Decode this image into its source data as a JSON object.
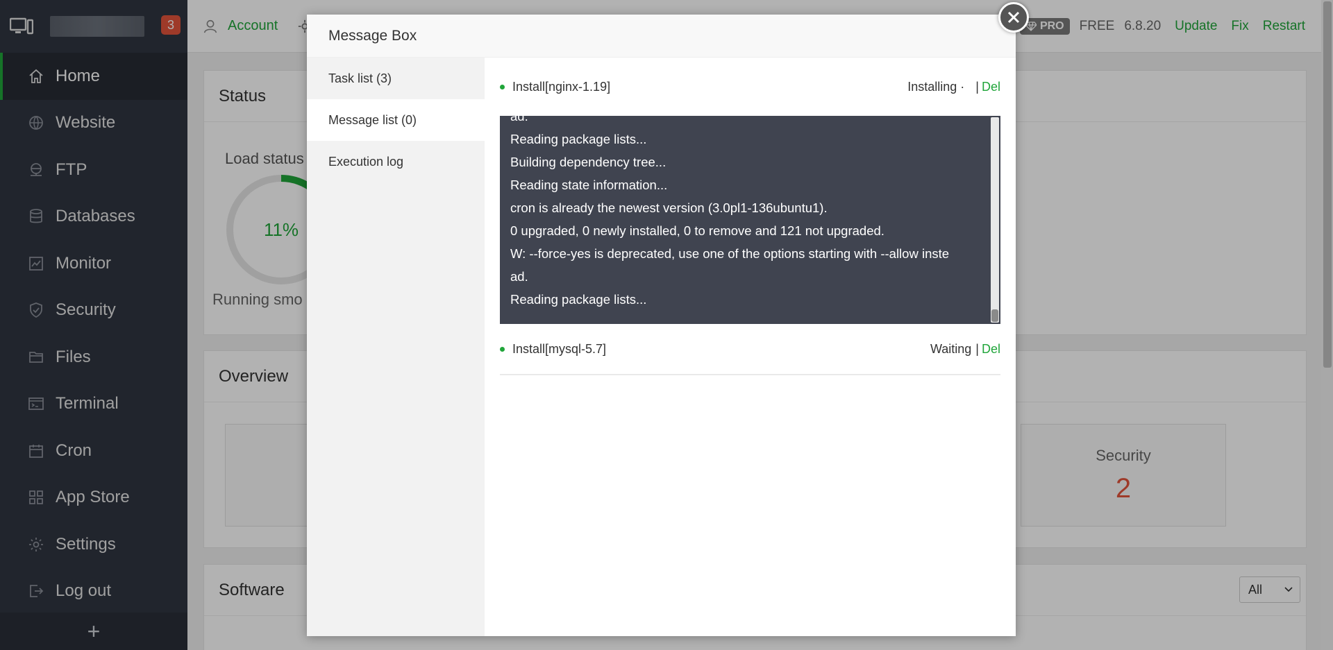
{
  "sidebar": {
    "badge_count": "3",
    "items": [
      {
        "label": "Home",
        "icon": "home-icon"
      },
      {
        "label": "Website",
        "icon": "globe-icon"
      },
      {
        "label": "FTP",
        "icon": "ftp-icon"
      },
      {
        "label": "Databases",
        "icon": "database-icon"
      },
      {
        "label": "Monitor",
        "icon": "monitor-chart-icon"
      },
      {
        "label": "Security",
        "icon": "shield-icon"
      },
      {
        "label": "Files",
        "icon": "folder-icon"
      },
      {
        "label": "Terminal",
        "icon": "terminal-icon"
      },
      {
        "label": "Cron",
        "icon": "calendar-icon"
      },
      {
        "label": "App Store",
        "icon": "grid-icon"
      },
      {
        "label": "Settings",
        "icon": "gear-icon"
      },
      {
        "label": "Log out",
        "icon": "logout-icon"
      }
    ],
    "add_label": "+"
  },
  "topbar": {
    "account_label": "Account",
    "pro_label": "PRO",
    "free_label": "FREE",
    "version": "6.8.20",
    "update_label": "Update",
    "fix_label": "Fix",
    "restart_label": "Restart"
  },
  "status": {
    "title": "Status",
    "load_title": "Load status",
    "load_percent": "11%",
    "load_value": 11,
    "running_text": "Running smo"
  },
  "overview": {
    "title": "Overview",
    "security_label": "Security",
    "security_value": "2"
  },
  "software": {
    "title": "Software",
    "filter_value": "All"
  },
  "modal": {
    "title": "Message Box",
    "tabs": [
      {
        "label": "Task list (3)"
      },
      {
        "label": "Message list (0)"
      },
      {
        "label": "Execution log"
      }
    ],
    "tasks": [
      {
        "name": "Install[nginx-1.19]",
        "status": "Installing ·",
        "separator": "|",
        "del_label": "Del"
      },
      {
        "name": "Install[mysql-5.7]",
        "status": "Waiting",
        "separator": "|",
        "del_label": "Del"
      }
    ],
    "console_lines": [
      "ad.",
      "Reading package lists...",
      "Building dependency tree...",
      "Reading state information...",
      "cron is already the newest version (3.0pl1-136ubuntu1).",
      "0 upgraded, 0 newly installed, 0 to remove and 121 not upgraded.",
      "W: --force-yes is deprecated, use one of the options starting with --allow inste",
      "ad.",
      "Reading package lists..."
    ]
  },
  "colors": {
    "accent": "#20a53a",
    "sidebar_bg": "#303641",
    "badge": "#e2533c",
    "console_bg": "#404450"
  }
}
